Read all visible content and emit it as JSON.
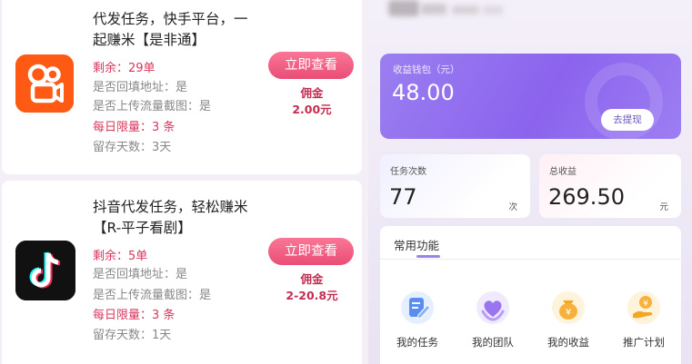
{
  "tasks": [
    {
      "title_line1": "代发任务，快手平台，一",
      "title_line2": "起赚米【是非通】",
      "remaining": "剩余：29单",
      "fill_address": "是否回填地址：是",
      "upload_screenshot": "是否上传流量截图：是",
      "daily_limit": "每日限量：3 条",
      "retention_days": "留存天数：3天",
      "cta_label": "立即查看",
      "commission_label": "佣金",
      "commission_value": "2.00元",
      "icon": "kuaishou-app-icon",
      "icon_color": "#ff5a14"
    },
    {
      "title_line1": "抖音代发任务，轻松赚米",
      "title_line2": "【R-平子看剧】",
      "remaining": "剩余：5单",
      "fill_address": "是否回填地址：是",
      "upload_screenshot": "是否上传流量截图：是",
      "daily_limit": "每日限量：3 条",
      "retention_days": "留存天数：1天",
      "cta_label": "立即查看",
      "commission_label": "佣金",
      "commission_value": "2-20.8元",
      "icon": "tiktok-app-icon",
      "icon_color": "#111111"
    }
  ],
  "wallet": {
    "label": "收益钱包（元）",
    "value": "48.00",
    "withdraw_label": "去提现"
  },
  "stats": [
    {
      "label": "任务次数",
      "value": "77",
      "unit": "次"
    },
    {
      "label": "总收益",
      "value": "269.50",
      "unit": "元"
    }
  ],
  "functions": {
    "title": "常用功能",
    "items": [
      {
        "label": "我的任务",
        "icon": "task-edit-icon"
      },
      {
        "label": "我的团队",
        "icon": "team-heart-icon"
      },
      {
        "label": "我的收益",
        "icon": "income-yen-bag-icon"
      },
      {
        "label": "推广计划",
        "icon": "promotion-hand-coin-icon"
      }
    ]
  },
  "colors": {
    "accent_pink": "#ea4d76",
    "accent_purple": "#8b63ee",
    "commission_red": "#c42d52"
  }
}
